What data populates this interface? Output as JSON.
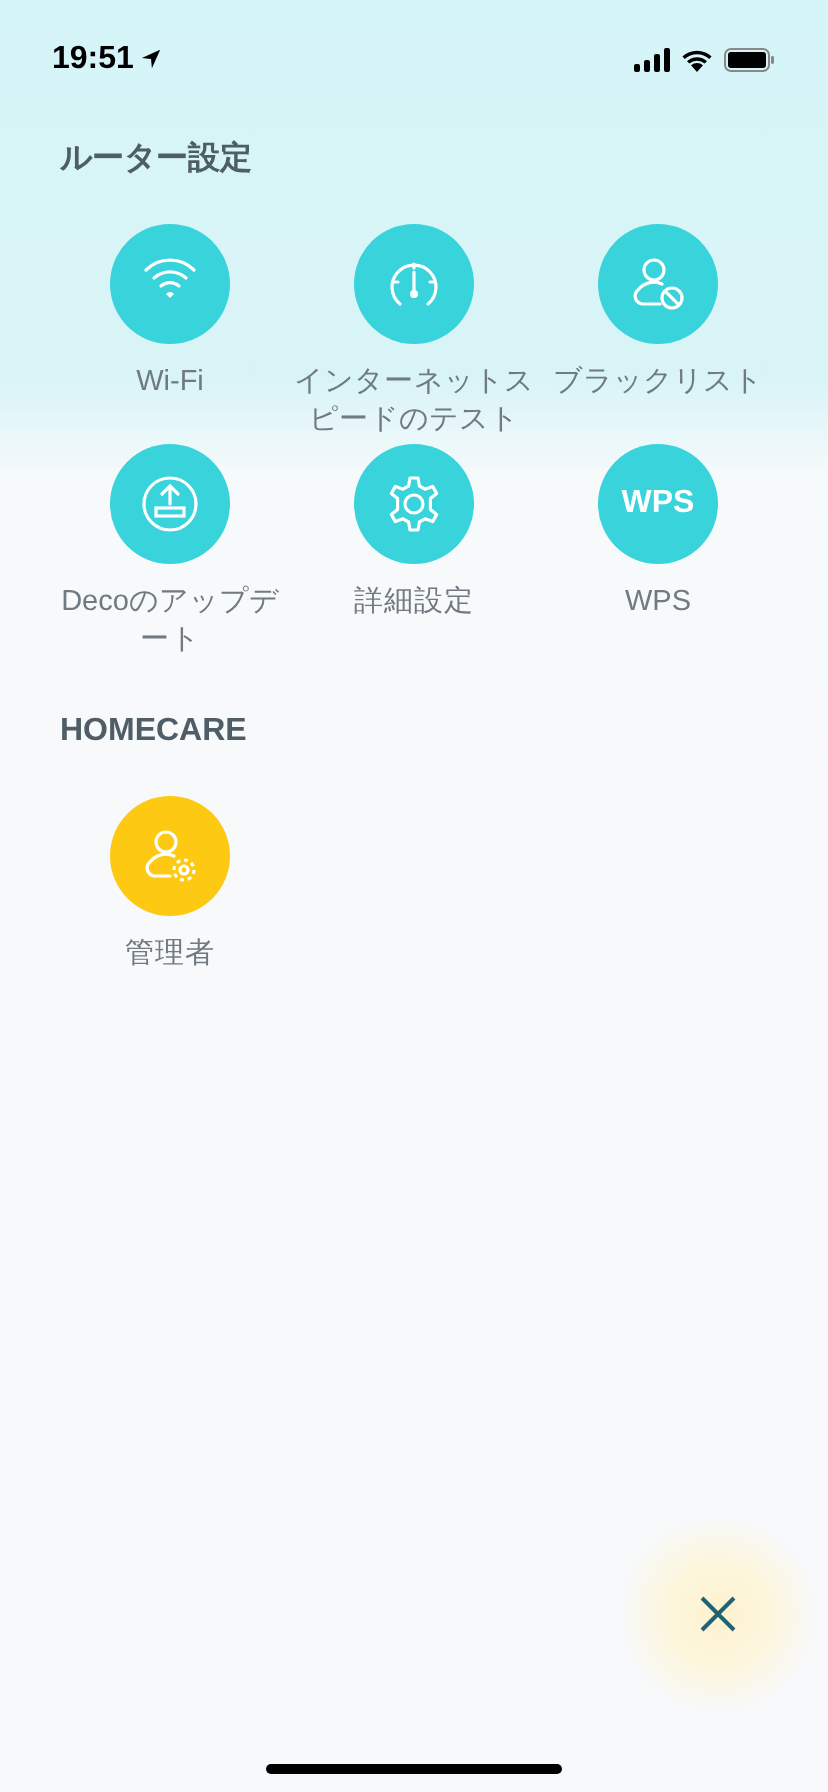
{
  "status_bar": {
    "time": "19:51"
  },
  "sections": [
    {
      "title": "ルーター設定",
      "items": [
        {
          "label": "Wi-Fi",
          "kind": "glyph",
          "color": "#38d3db"
        },
        {
          "label": "インターネットスピードのテスト",
          "kind": "glyph",
          "color": "#38d3db"
        },
        {
          "label": "ブラックリスト",
          "kind": "glyph",
          "color": "#38d3db"
        },
        {
          "label": "Decoのアップデート",
          "kind": "glyph",
          "color": "#38d3db"
        },
        {
          "label": "詳細設定",
          "kind": "glyph",
          "color": "#38d3db"
        },
        {
          "label": "WPS",
          "kind": "text",
          "icon_text": "WPS",
          "color": "#38d3db"
        }
      ]
    },
    {
      "title": "HOMECARE",
      "items": [
        {
          "label": "管理者",
          "kind": "glyph",
          "color": "#fec913"
        }
      ]
    }
  ]
}
